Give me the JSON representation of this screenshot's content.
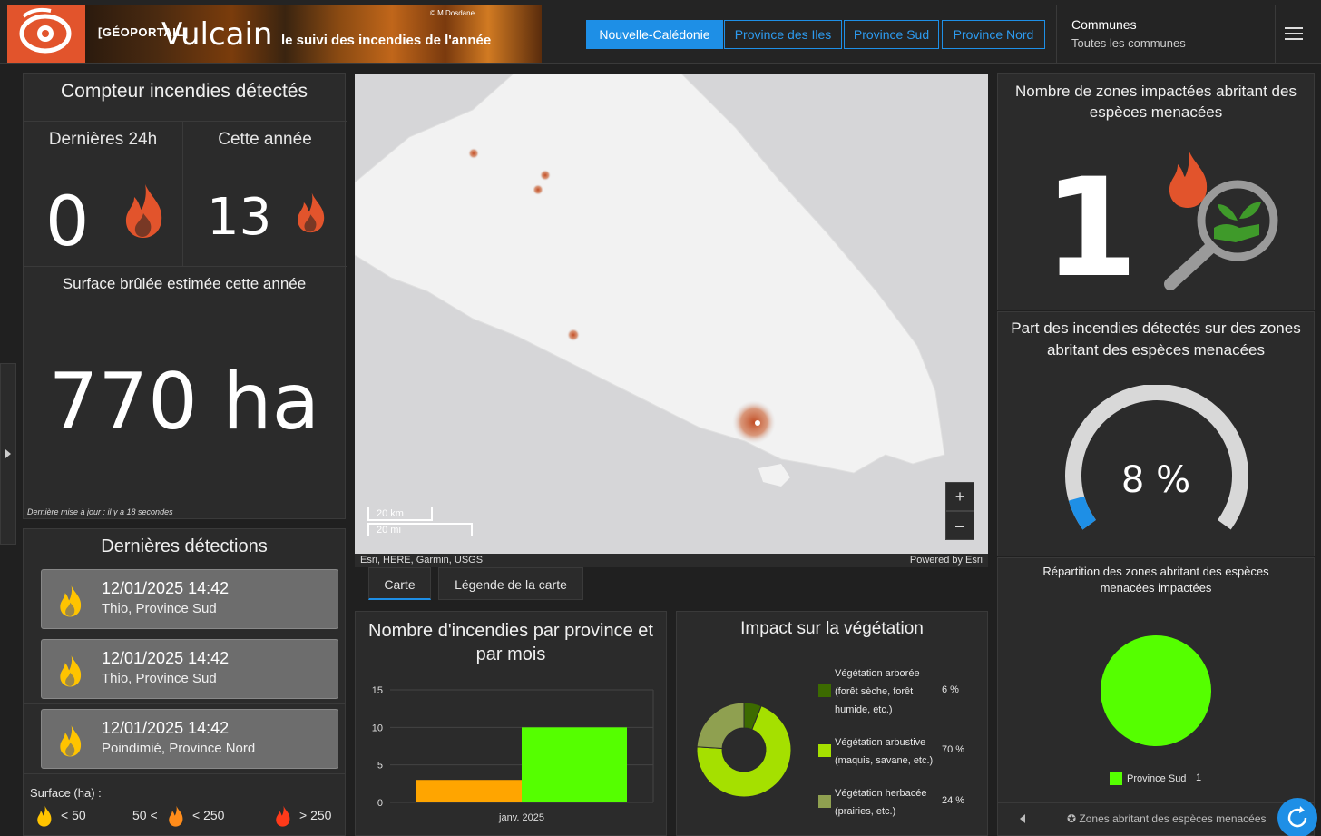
{
  "header": {
    "banner": {
      "credit": "© M.Dosdane",
      "geoportail": "[GÉOPORTAIL]",
      "app_name": "Vulcain",
      "tagline": "le suivi des incendies de l'année"
    },
    "nav": [
      {
        "label": "Nouvelle-Calédonie",
        "active": true
      },
      {
        "label": "Province des Iles",
        "active": false
      },
      {
        "label": "Province Sud",
        "active": false
      },
      {
        "label": "Province Nord",
        "active": false
      }
    ],
    "communes": {
      "label": "Communes",
      "value": "Toutes les communes"
    },
    "menu_icon": "hamburger-icon"
  },
  "counter": {
    "title": "Compteur incendies détectés",
    "last24h_label": "Dernières 24h",
    "last24h_value": "0",
    "year_label": "Cette année",
    "year_value": "13"
  },
  "surface": {
    "title": "Surface brûlée estimée cette année",
    "value": "770 ha",
    "updated": "Dernière mise à jour : il y a 18 secondes"
  },
  "detections": {
    "title": "Dernières détections",
    "items": [
      {
        "datetime": "12/01/2025 14:42",
        "place": "Thio, Province Sud"
      },
      {
        "datetime": "12/01/2025 14:42",
        "place": "Thio, Province Sud"
      },
      {
        "datetime": "12/01/2025 14:42",
        "place": "Poindimié, Province Nord"
      }
    ],
    "legend_title": "Surface (ha) :",
    "legend": [
      "< 50",
      "50 <",
      "< 250",
      "> 250"
    ]
  },
  "map": {
    "scale_km": "20 km",
    "scale_mi": "20 mi",
    "attribution": "Esri, HERE, Garmin, USGS",
    "powered": "Powered by Esri",
    "zoom_in": "+",
    "zoom_out": "–"
  },
  "tabs": [
    {
      "label": "Carte",
      "active": true
    },
    {
      "label": "Légende de la carte",
      "active": false
    }
  ],
  "species": {
    "zones_title": "Nombre de zones impactées abritant des espèces menacées",
    "zones_value": "1",
    "share_title": "Part des incendies détectés sur des zones abritant des espèces menacées",
    "share_value": "8 %",
    "share_fraction": 0.08,
    "repartition_title": "Répartition des zones abritant des espèces menacées impactées",
    "repartition_legend": {
      "label": "Province Sud",
      "value": "1",
      "color": "#55ff00"
    },
    "footer": "Zones abritant des espèces menacées"
  },
  "colors": {
    "accent": "#1e8fe6",
    "orange": "#ffa500",
    "green": "#55ff00",
    "fire": "#e2542c"
  },
  "chart_data": [
    {
      "type": "bar",
      "title": "Nombre d'incendies par province et par mois",
      "categories": [
        "janv. 2025"
      ],
      "series": [
        {
          "values": [
            3
          ],
          "color": "#ffa500"
        },
        {
          "values": [
            10
          ],
          "color": "#55ff00"
        }
      ],
      "ylim": [
        0,
        15
      ],
      "yticks": [
        0,
        5,
        10,
        15
      ],
      "grid": true
    },
    {
      "type": "pie",
      "title": "Impact sur la végétation",
      "slices": [
        {
          "label": "Végétation arborée (forêt sèche, forêt humide, etc.)",
          "value": 6,
          "value_label": "6 %",
          "color": "#3c6a00"
        },
        {
          "label": "Végétation arbustive (maquis, savane, etc.)",
          "value": 70,
          "value_label": "70 %",
          "color": "#a5e000"
        },
        {
          "label": "Végétation herbacée (prairies, etc.)",
          "value": 24,
          "value_label": "24 %",
          "color": "#8fa050"
        }
      ]
    },
    {
      "type": "pie",
      "title": "Répartition des zones abritant des espèces menacées impactées",
      "slices": [
        {
          "label": "Province Sud",
          "value": 1,
          "color": "#55ff00"
        }
      ]
    }
  ]
}
